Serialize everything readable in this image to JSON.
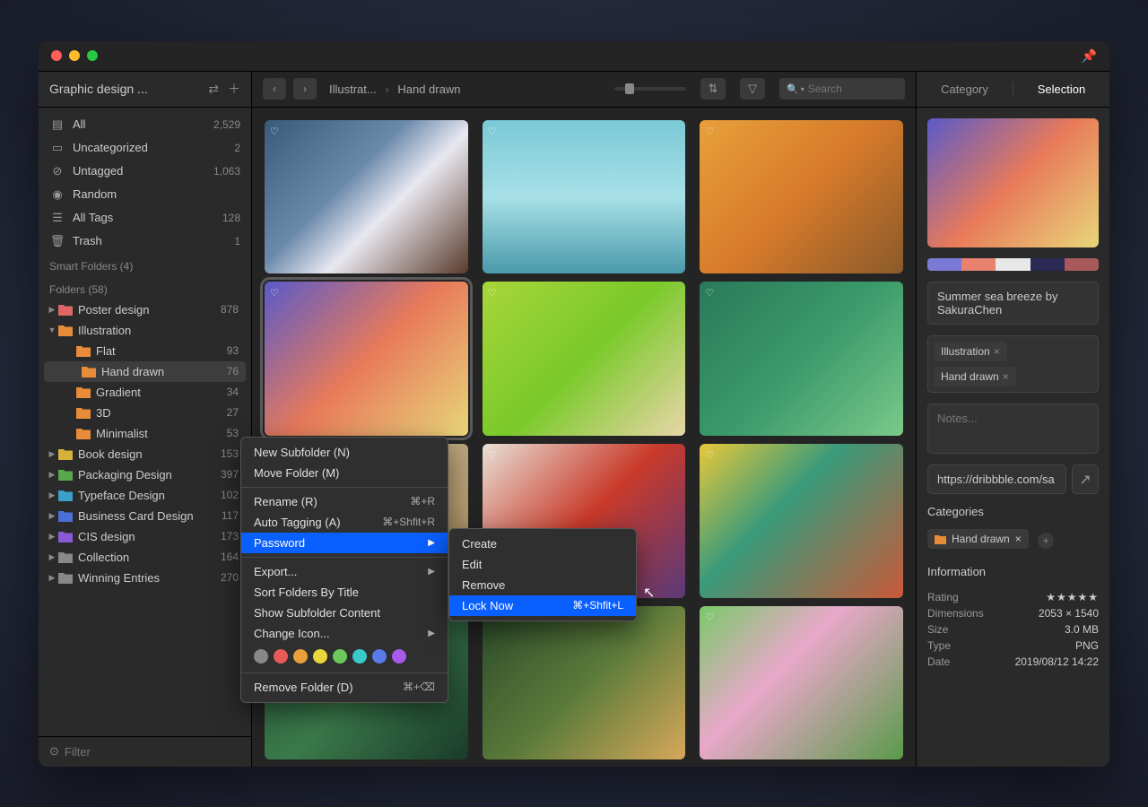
{
  "sidebar": {
    "title": "Graphic design ...",
    "smart": [
      {
        "icon": "all",
        "label": "All",
        "count": "2,529"
      },
      {
        "icon": "uncat",
        "label": "Uncategorized",
        "count": "2"
      },
      {
        "icon": "untag",
        "label": "Untagged",
        "count": "1,063"
      },
      {
        "icon": "random",
        "label": "Random",
        "count": ""
      },
      {
        "icon": "tags",
        "label": "All Tags",
        "count": "128"
      },
      {
        "icon": "trash",
        "label": "Trash",
        "count": "1"
      }
    ],
    "smart_folders_label": "Smart Folders (4)",
    "folders_label": "Folders (58)",
    "folders": [
      {
        "indent": 0,
        "expanded": false,
        "color": "#d66",
        "label": "Poster design",
        "count": "878"
      },
      {
        "indent": 0,
        "expanded": true,
        "color": "#e88c3a",
        "label": "Illustration",
        "count": ""
      },
      {
        "indent": 1,
        "expanded": null,
        "color": "#e88c3a",
        "label": "Flat",
        "count": "93"
      },
      {
        "indent": 1,
        "expanded": null,
        "color": "#e88c3a",
        "label": "Hand drawn",
        "count": "76",
        "selected": true
      },
      {
        "indent": 1,
        "expanded": null,
        "color": "#e88c3a",
        "label": "Gradient",
        "count": "34"
      },
      {
        "indent": 1,
        "expanded": null,
        "color": "#e88c3a",
        "label": "3D",
        "count": "27"
      },
      {
        "indent": 1,
        "expanded": null,
        "color": "#e88c3a",
        "label": "Minimalist",
        "count": "53"
      },
      {
        "indent": 0,
        "expanded": false,
        "color": "#d6b13c",
        "label": "Book design",
        "count": "153"
      },
      {
        "indent": 0,
        "expanded": false,
        "color": "#5aa84e",
        "label": "Packaging Design",
        "count": "397"
      },
      {
        "indent": 0,
        "expanded": false,
        "color": "#3aa0c9",
        "label": "Typeface Design",
        "count": "102"
      },
      {
        "indent": 0,
        "expanded": false,
        "color": "#4a6fd6",
        "label": "Business Card Design",
        "count": "117"
      },
      {
        "indent": 0,
        "expanded": false,
        "color": "#8a5ad6",
        "label": "CIS design",
        "count": "173"
      },
      {
        "indent": 0,
        "expanded": false,
        "color": "#888",
        "label": "Collection",
        "count": "164"
      },
      {
        "indent": 0,
        "expanded": false,
        "color": "#888",
        "label": "Winning Entries",
        "count": "270"
      }
    ],
    "filter_placeholder": "Filter"
  },
  "toolbar": {
    "breadcrumb": [
      "Illustrat...",
      "Hand drawn"
    ],
    "search_placeholder": "Search"
  },
  "inspector": {
    "tabs": [
      "Category",
      "Selection"
    ],
    "palette": [
      "#7a7ad6",
      "#e8826e",
      "#e8e8e8",
      "#2a2a55",
      "#a85a5a"
    ],
    "title": "Summer sea breeze by SakuraChen",
    "tags": [
      "Illustration",
      "Hand drawn"
    ],
    "notes_placeholder": "Notes...",
    "url": "https://dribbble.com/sa",
    "categories_label": "Categories",
    "category_chip": "Hand drawn",
    "info_label": "Information",
    "info": [
      {
        "k": "Rating",
        "v": "★★★★★",
        "stars": true
      },
      {
        "k": "Dimensions",
        "v": "2053 × 1540"
      },
      {
        "k": "Size",
        "v": "3.0 MB"
      },
      {
        "k": "Type",
        "v": "PNG"
      },
      {
        "k": "Date",
        "v": "2019/08/12 14:22"
      }
    ]
  },
  "context_menu": {
    "items": [
      {
        "label": "New Subfolder (N)"
      },
      {
        "label": "Move Folder (M)"
      },
      {
        "sep": true
      },
      {
        "label": "Rename (R)",
        "shortcut": "⌘+R"
      },
      {
        "label": "Auto Tagging (A)",
        "shortcut": "⌘+Shfit+R"
      },
      {
        "label": "Password",
        "submenu": true,
        "hover": true
      },
      {
        "sep": true
      },
      {
        "label": "Export...",
        "submenu": true
      },
      {
        "label": "Sort Folders By Title"
      },
      {
        "label": "Show Subfolder Content"
      },
      {
        "label": "Change Icon...",
        "submenu": true
      },
      {
        "colors": [
          "#888",
          "#e85a5a",
          "#e8a03a",
          "#e8d63a",
          "#6ac95a",
          "#3ac9c9",
          "#5a7ae8",
          "#a85ae8"
        ]
      },
      {
        "sep": true
      },
      {
        "label": "Remove Folder (D)",
        "shortcut": "⌘+⌫"
      }
    ],
    "submenu": [
      {
        "label": "Create"
      },
      {
        "label": "Edit"
      },
      {
        "label": "Remove"
      },
      {
        "label": "Lock Now",
        "shortcut": "⌘+Shfit+L",
        "hover": true
      }
    ]
  },
  "thumbs": [
    {
      "g": "linear-gradient(135deg,#3a5a7a 0%,#6a8aaa 40%,#e8e8f0 60%,#5a3a2a 100%)"
    },
    {
      "g": "linear-gradient(180deg,#7ac9d6 0%,#a8e0e8 50%,#4a9aaa 100%)"
    },
    {
      "g": "linear-gradient(135deg,#e8a03a 0%,#d67a2a 50%,#8a5a2a 100%)"
    },
    {
      "g": "linear-gradient(135deg,#5a5ac9 0%,#e87a5a 50%,#e8d67a 100%)",
      "selected": true
    },
    {
      "g": "linear-gradient(135deg,#a8d63a 0%,#7ac92a 50%,#e8d6a8 100%)"
    },
    {
      "g": "linear-gradient(135deg,#2a7a5a 0%,#3a9a6a 50%,#7ac98a 100%)"
    },
    {
      "g": "linear-gradient(135deg,#d6c9a8 0%,#a88a5a 100%)"
    },
    {
      "g": "linear-gradient(135deg,#e8e0d6 0%,#c93a2a 50%,#5a3a7a 100%)"
    },
    {
      "g": "linear-gradient(135deg,#e8c93a 0%,#3a9a7a 40%,#c95a3a 100%)"
    },
    {
      "g": "linear-gradient(135deg,#2a5a3a 0%,#3a7a4a 50%,#1a3a2a 100%)"
    },
    {
      "g": "linear-gradient(135deg,#2a4a2a 0%,#5a7a3a 50%,#d6a85a 100%)"
    },
    {
      "g": "linear-gradient(135deg,#7ac96a 0%,#e8a8c9 40%,#5a9a4a 100%)"
    }
  ]
}
